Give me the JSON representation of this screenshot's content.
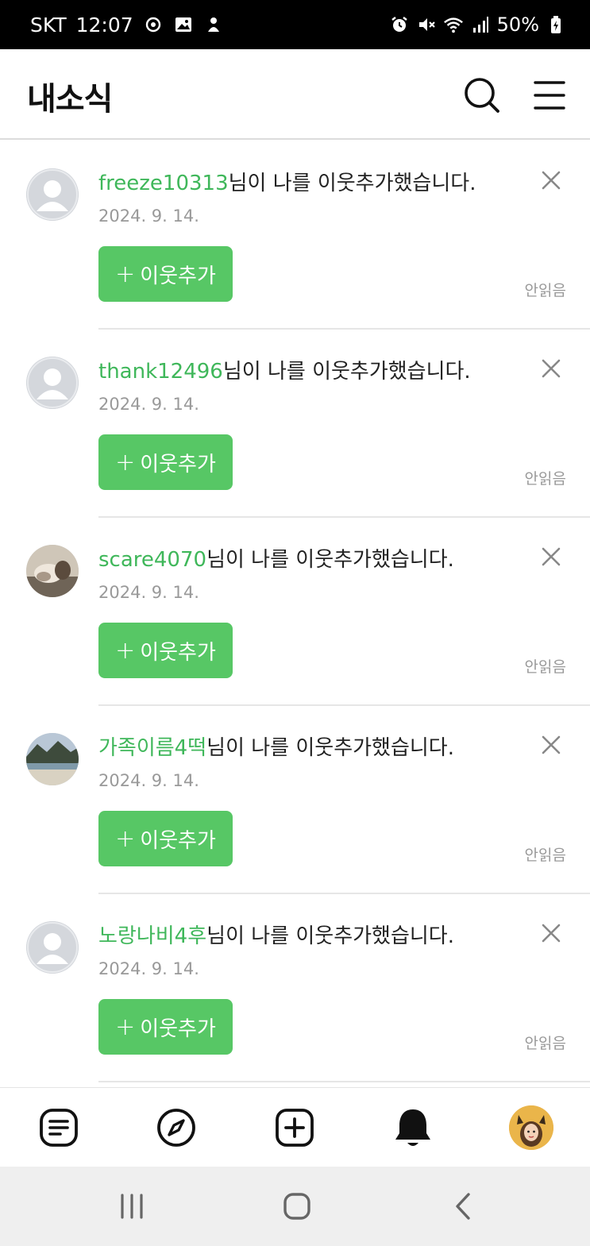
{
  "status_bar": {
    "carrier": "SKT",
    "time": "12:07",
    "battery": "50%"
  },
  "header": {
    "title": "내소식"
  },
  "notifications": [
    {
      "nickname": "freeze10313",
      "message": "님이 나를 이웃추가했습니다.",
      "date": "2024. 9. 14.",
      "button_label": "이웃추가",
      "read_status": "안읽음",
      "avatar": "default"
    },
    {
      "nickname": "thank12496",
      "message": "님이 나를 이웃추가했습니다.",
      "date": "2024. 9. 14.",
      "button_label": "이웃추가",
      "read_status": "안읽음",
      "avatar": "default"
    },
    {
      "nickname": "scare4070",
      "message": "님이 나를 이웃추가했습니다.",
      "date": "2024. 9. 14.",
      "button_label": "이웃추가",
      "read_status": "안읽음",
      "avatar": "photo-cat"
    },
    {
      "nickname": "가족이름4떡",
      "message": "님이 나를 이웃추가했습니다.",
      "date": "2024. 9. 14.",
      "button_label": "이웃추가",
      "read_status": "안읽음",
      "avatar": "photo-landscape"
    },
    {
      "nickname": "노랑나비4후",
      "message": "님이 나를 이웃추가했습니다.",
      "date": "2024. 9. 14.",
      "button_label": "이웃추가",
      "read_status": "안읽음",
      "avatar": "default"
    }
  ],
  "tab_bar": {
    "tabs": [
      "feed-icon",
      "compass-icon",
      "add-post-icon",
      "bell-icon",
      "profile-avatar"
    ],
    "active": "bell-icon"
  },
  "nav_bar": {
    "buttons": [
      "recent-apps-icon",
      "home-icon",
      "back-icon"
    ]
  },
  "colors": {
    "accent_green": "#57c765",
    "nickname_green": "#3fb75a",
    "muted_text": "#999999"
  }
}
